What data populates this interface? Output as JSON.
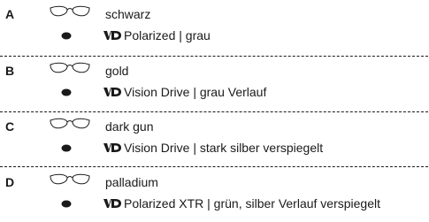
{
  "variants": [
    {
      "letter": "A",
      "frame": "schwarz",
      "lens": "Polarized | grau"
    },
    {
      "letter": "B",
      "frame": "gold",
      "lens": "Vision Drive | grau Verlauf"
    },
    {
      "letter": "C",
      "frame": "dark gun",
      "lens": "Vision Drive | stark silber verspiegelt"
    },
    {
      "letter": "D",
      "frame": "palladium",
      "lens": "Polarized XTR | grün, silber Verlauf verspiegelt"
    }
  ],
  "icons": {
    "frame": "glasses-outline-icon",
    "lens": "lens-swatch-icon",
    "lens_brand": "vd-logo-icon"
  }
}
